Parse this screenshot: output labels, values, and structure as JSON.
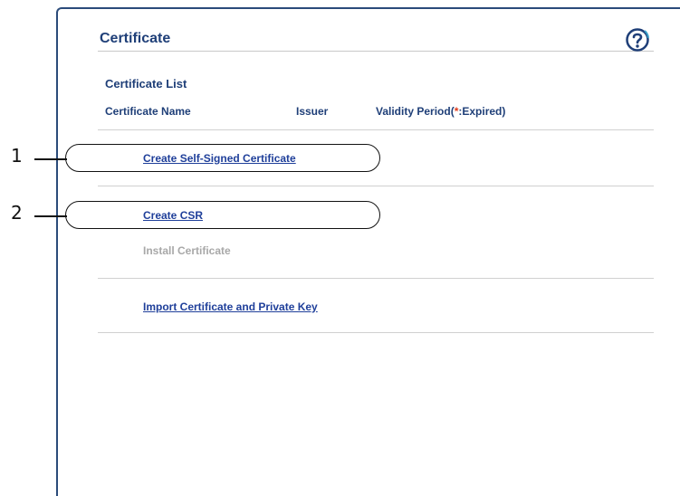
{
  "header": {
    "title": "Certificate",
    "help_icon": "question-mark-circle-icon"
  },
  "certificate_list": {
    "heading": "Certificate List",
    "columns": {
      "name": "Certificate Name",
      "issuer": "Issuer",
      "validity_prefix": "Validity Period(",
      "validity_asterisk": "*",
      "validity_suffix": ":Expired)"
    }
  },
  "actions": {
    "create_self_signed": "Create Self-Signed Certificate",
    "create_csr": "Create CSR",
    "install_certificate": "Install Certificate",
    "import_certificate": "Import Certificate and Private Key"
  },
  "callouts": {
    "one": "1",
    "two": "2"
  },
  "colors": {
    "heading": "#1f3f78",
    "link": "#1f3f9a",
    "disabled": "#a8a8a8",
    "expired_marker": "#e03a1a"
  }
}
